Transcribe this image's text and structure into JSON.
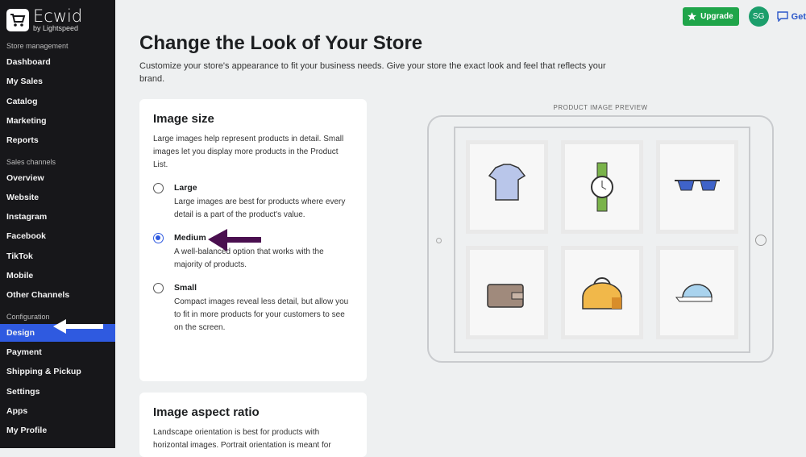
{
  "brand": {
    "name": "Ecwid",
    "sub": "by Lightspeed"
  },
  "sidebar": {
    "sections": [
      {
        "label": "Store management",
        "items": [
          "Dashboard",
          "My Sales",
          "Catalog",
          "Marketing",
          "Reports"
        ]
      },
      {
        "label": "Sales channels",
        "items": [
          "Overview",
          "Website",
          "Instagram",
          "Facebook",
          "TikTok",
          "Mobile",
          "Other Channels"
        ]
      },
      {
        "label": "Configuration",
        "items": [
          "Design",
          "Payment",
          "Shipping & Pickup",
          "Settings",
          "Apps",
          "My Profile"
        ]
      }
    ],
    "active": "Design"
  },
  "topbar": {
    "upgrade": "Upgrade",
    "avatar": "SG",
    "get": "Get"
  },
  "page": {
    "title": "Change the Look of Your Store",
    "subtitle": "Customize your store's appearance to fit your business needs. Give your store the exact look and feel that reflects your brand."
  },
  "image_size": {
    "title": "Image size",
    "desc": "Large images help represent products in detail. Small images let you display more products in the Product List.",
    "options": [
      {
        "label": "Large",
        "desc": "Large images are best for products where every detail is a part of the product's value."
      },
      {
        "label": "Medium",
        "desc": "A well-balanced option that works with the majority of products."
      },
      {
        "label": "Small",
        "desc": "Compact images reveal less detail, but allow you to fit in more products for your customers to see on the screen."
      }
    ],
    "selected": "Medium"
  },
  "aspect_ratio": {
    "title": "Image aspect ratio",
    "desc": "Landscape orientation is best for products with horizontal images. Portrait orientation is meant for"
  },
  "preview": {
    "label": "PRODUCT IMAGE PREVIEW",
    "products": [
      "t-shirt-icon",
      "watch-icon",
      "sunglasses-icon",
      "wallet-icon",
      "bag-icon",
      "cap-icon"
    ]
  },
  "colors": {
    "sidebar": "#17171a",
    "accent": "#2f5ae0",
    "upgrade": "#1fa54a",
    "annotation_arrow": "#4a0f4f"
  }
}
